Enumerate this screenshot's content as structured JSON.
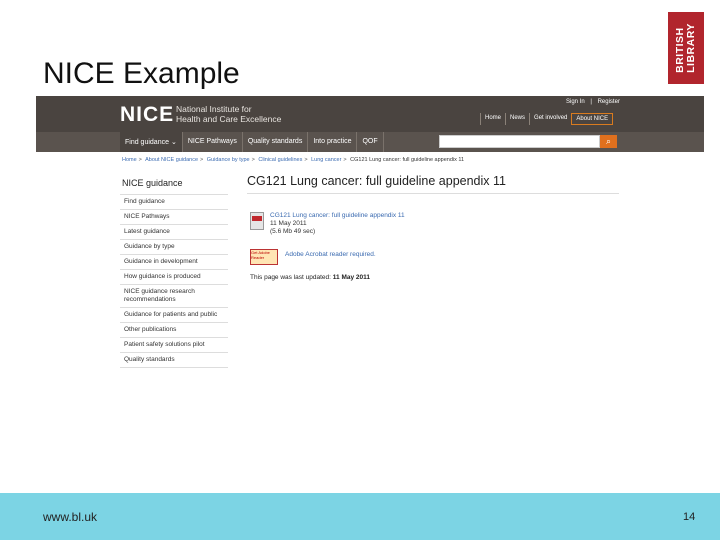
{
  "slide": {
    "title": "NICE Example",
    "footer_url": "www.bl.uk",
    "page_number": "14"
  },
  "bl_logo": {
    "line1": "BRITISH",
    "line2": "LIBRARY"
  },
  "nice": {
    "logo": "NICE",
    "subtitle_line1": "National Institute for",
    "subtitle_line2": "Health and Care Excellence",
    "top_links": [
      "Sign In",
      "|",
      "Register"
    ],
    "top_nav": [
      "Home",
      "News",
      "Get involved",
      "About NICE"
    ],
    "nav": [
      "Find guidance",
      "NICE Pathways",
      "Quality standards",
      "Into practice",
      "QOF"
    ],
    "breadcrumb": [
      "Home",
      "About NICE guidance",
      "Guidance by type",
      "Clinical guidelines",
      "Lung cancer",
      "CG121 Lung cancer: full guideline appendix 11"
    ],
    "sidebar_title": "NICE guidance",
    "sidebar": [
      "Find guidance",
      "NICE Pathways",
      "Latest guidance",
      "Guidance by type",
      "Guidance in development",
      "How guidance is produced",
      "NICE guidance research recommendations",
      "Guidance for patients and public",
      "Other publications",
      "Patient safety solutions pilot",
      "Quality standards"
    ],
    "main_title": "CG121 Lung cancer: full guideline appendix 11",
    "doc": {
      "link": "CG121 Lung cancer: full guideline appendix 11",
      "date": "11 May 2011",
      "size": "(5.6 Mb 49 sec)"
    },
    "adobe": {
      "logo_text": "Get Adobe Reader",
      "text": "Adobe Acrobat reader required."
    },
    "updated_prefix": "This page was last updated:",
    "updated_date": "11 May 2011"
  }
}
